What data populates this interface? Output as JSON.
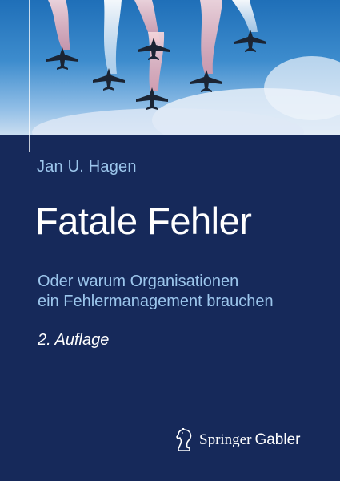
{
  "author": "Jan U. Hagen",
  "title": "Fatale Fehler",
  "subtitle_lines": [
    "Oder warum Organisationen",
    "ein Fehlermanagement brauchen"
  ],
  "edition": "2. Auflage",
  "publisher": {
    "springer": "Springer",
    "imprint": "Gabler"
  },
  "colors": {
    "background": "#16295a",
    "accent_text": "#9cc6ec",
    "sky": "#3d8ccd"
  }
}
